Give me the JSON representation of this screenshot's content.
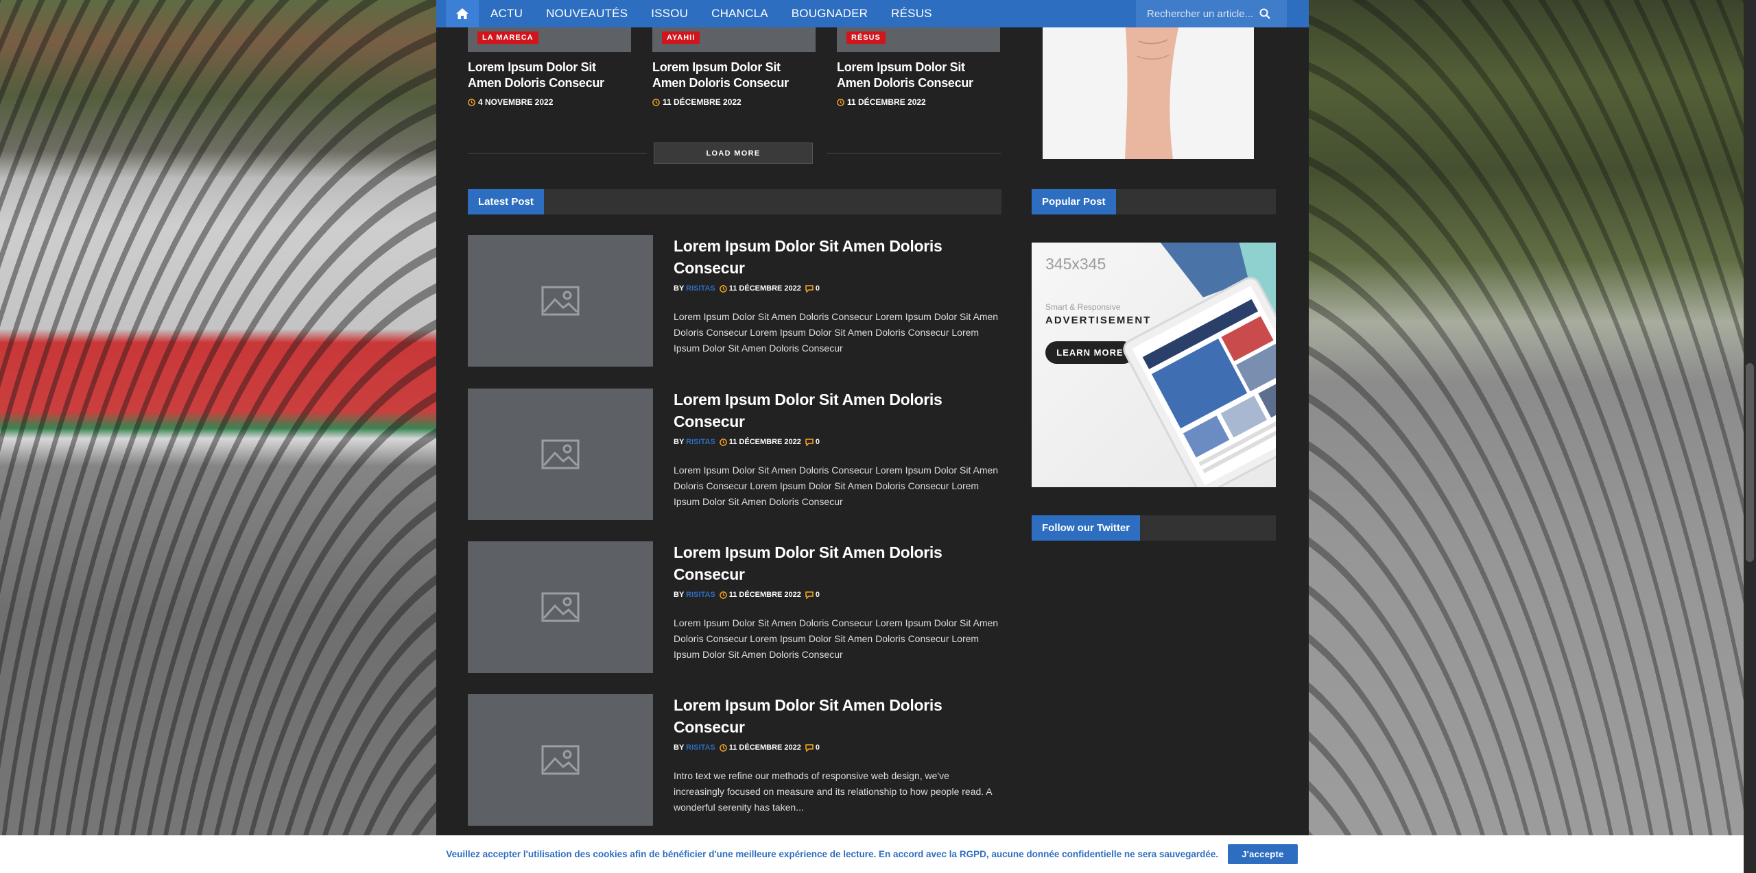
{
  "nav": {
    "items": [
      "ACTU",
      "NOUVEAUTÉS",
      "ISSOU",
      "CHANCLA",
      "BOUGNADER",
      "RÉSUS"
    ],
    "search_placeholder": "Rechercher un article..."
  },
  "top_cards": [
    {
      "badge": "LA MARECA",
      "title": "Lorem Ipsum Dolor Sit Amen Doloris Consecur",
      "date": "4 NOVEMBRE 2022"
    },
    {
      "badge": "AYAHII",
      "title": "Lorem Ipsum Dolor Sit Amen Doloris Consecur",
      "date": "11 DÉCEMBRE 2022"
    },
    {
      "badge": "RÉSUS",
      "title": "Lorem Ipsum Dolor Sit Amen Doloris Consecur",
      "date": "11 DÉCEMBRE 2022"
    }
  ],
  "load_more": "LOAD MORE",
  "latest_post": {
    "heading": "Latest Post",
    "posts": [
      {
        "title": "Lorem Ipsum Dolor Sit Amen Doloris Consecur",
        "by": "BY",
        "author": "RISITAS",
        "date": "11 DÉCEMBRE 2022",
        "comments": "0",
        "excerpt": "Lorem Ipsum Dolor Sit Amen Doloris Consecur Lorem Ipsum Dolor Sit Amen Doloris Consecur Lorem Ipsum Dolor Sit Amen Doloris Consecur Lorem Ipsum Dolor Sit Amen Doloris Consecur"
      },
      {
        "title": "Lorem Ipsum Dolor Sit Amen Doloris Consecur",
        "by": "BY",
        "author": "RISITAS",
        "date": "11 DÉCEMBRE 2022",
        "comments": "0",
        "excerpt": "Lorem Ipsum Dolor Sit Amen Doloris Consecur Lorem Ipsum Dolor Sit Amen Doloris Consecur Lorem Ipsum Dolor Sit Amen Doloris Consecur Lorem Ipsum Dolor Sit Amen Doloris Consecur"
      },
      {
        "title": "Lorem Ipsum Dolor Sit Amen Doloris Consecur",
        "by": "BY",
        "author": "RISITAS",
        "date": "11 DÉCEMBRE 2022",
        "comments": "0",
        "excerpt": "Lorem Ipsum Dolor Sit Amen Doloris Consecur Lorem Ipsum Dolor Sit Amen Doloris Consecur Lorem Ipsum Dolor Sit Amen Doloris Consecur Lorem Ipsum Dolor Sit Amen Doloris Consecur"
      },
      {
        "title": "Lorem Ipsum Dolor Sit Amen Doloris Consecur",
        "by": "BY",
        "author": "RISITAS",
        "date": "11 DÉCEMBRE 2022",
        "comments": "0",
        "excerpt": "Intro text we refine our methods of responsive web design, we've increasingly focused on measure and its relationship to how people read. A wonderful serenity has taken..."
      }
    ]
  },
  "popular_post": {
    "heading": "Popular Post"
  },
  "ad": {
    "size": "345x345",
    "sub": "Smart & Responsive",
    "title": "ADVERTISEMENT",
    "button": "LEARN MORE"
  },
  "twitter": {
    "heading": "Follow our Twitter"
  },
  "cookie": {
    "text": "Veuillez accepter l'utilisation des cookies afin de bénéficier d'une meilleure expérience de lecture. En accord avec la RGPD, aucune donnée confidentielle ne sera sauvegardée.",
    "button": "J'accepte"
  },
  "colors": {
    "accent": "#2d6ec1",
    "badge": "#d0151d",
    "background": "#222222"
  }
}
